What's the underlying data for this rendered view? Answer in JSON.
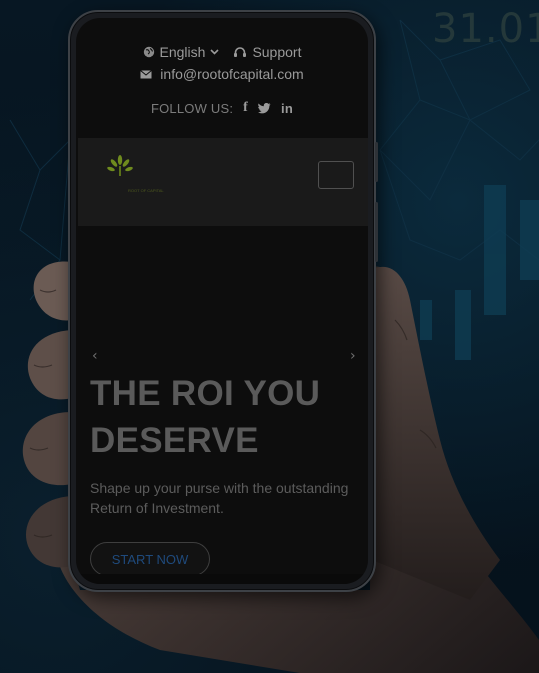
{
  "background": {
    "number_text": "31.01",
    "colors": {
      "base": "#06101a",
      "accent": "#0b2a3c"
    }
  },
  "topbar": {
    "language": "English",
    "support": "Support",
    "email": "info@rootofcapital.com",
    "follow_label": "FOLLOW US:",
    "social": {
      "facebook": "f",
      "twitter": "🐦",
      "linkedin": "in"
    }
  },
  "header": {
    "logo_text": "ROOT OF CAPITAL"
  },
  "hero": {
    "prev_arrow": "‹",
    "next_arrow": "›",
    "title": "THE ROI YOU DESERVE",
    "subtitle": "Shape up your purse with the outstanding Return of Investment.",
    "cta_label": "START NOW"
  },
  "icons": {
    "globe": "globe-icon",
    "chevron": "chevron-down-icon",
    "support": "headset-icon",
    "mail": "mail-icon",
    "menu": "menu-icon"
  }
}
